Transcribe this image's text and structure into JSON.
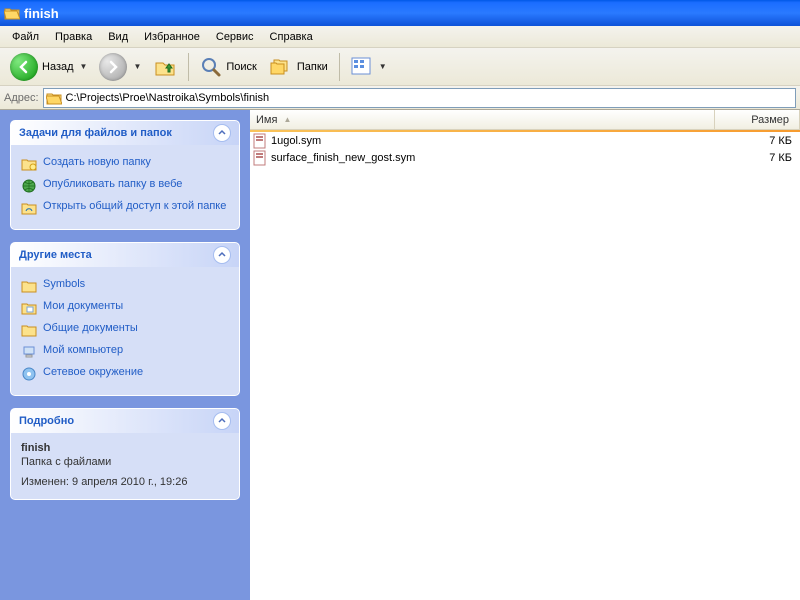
{
  "window": {
    "title": "finish"
  },
  "menu": {
    "file": "Файл",
    "edit": "Правка",
    "view": "Вид",
    "favorites": "Избранное",
    "tools": "Сервис",
    "help": "Справка"
  },
  "toolbar": {
    "back": "Назад",
    "search": "Поиск",
    "folders": "Папки"
  },
  "address": {
    "label": "Адрес:",
    "path": "C:\\Projects\\Proe\\Nastroika\\Symbols\\finish"
  },
  "tasks": {
    "title": "Задачи для файлов и папок",
    "items": [
      "Создать новую папку",
      "Опубликовать папку в вебе",
      "Открыть общий доступ к этой папке"
    ]
  },
  "places": {
    "title": "Другие места",
    "items": [
      "Symbols",
      "Мои документы",
      "Общие документы",
      "Мой компьютер",
      "Сетевое окружение"
    ]
  },
  "details": {
    "title": "Подробно",
    "name": "finish",
    "type": "Папка с файлами",
    "modified_label": "Изменен:",
    "modified": "9 апреля 2010 г., 19:26"
  },
  "columns": {
    "name": "Имя",
    "size": "Размер"
  },
  "files": [
    {
      "name": "1ugol.sym",
      "size": "7 КБ"
    },
    {
      "name": "surface_finish_new_gost.sym",
      "size": "7 КБ"
    }
  ]
}
